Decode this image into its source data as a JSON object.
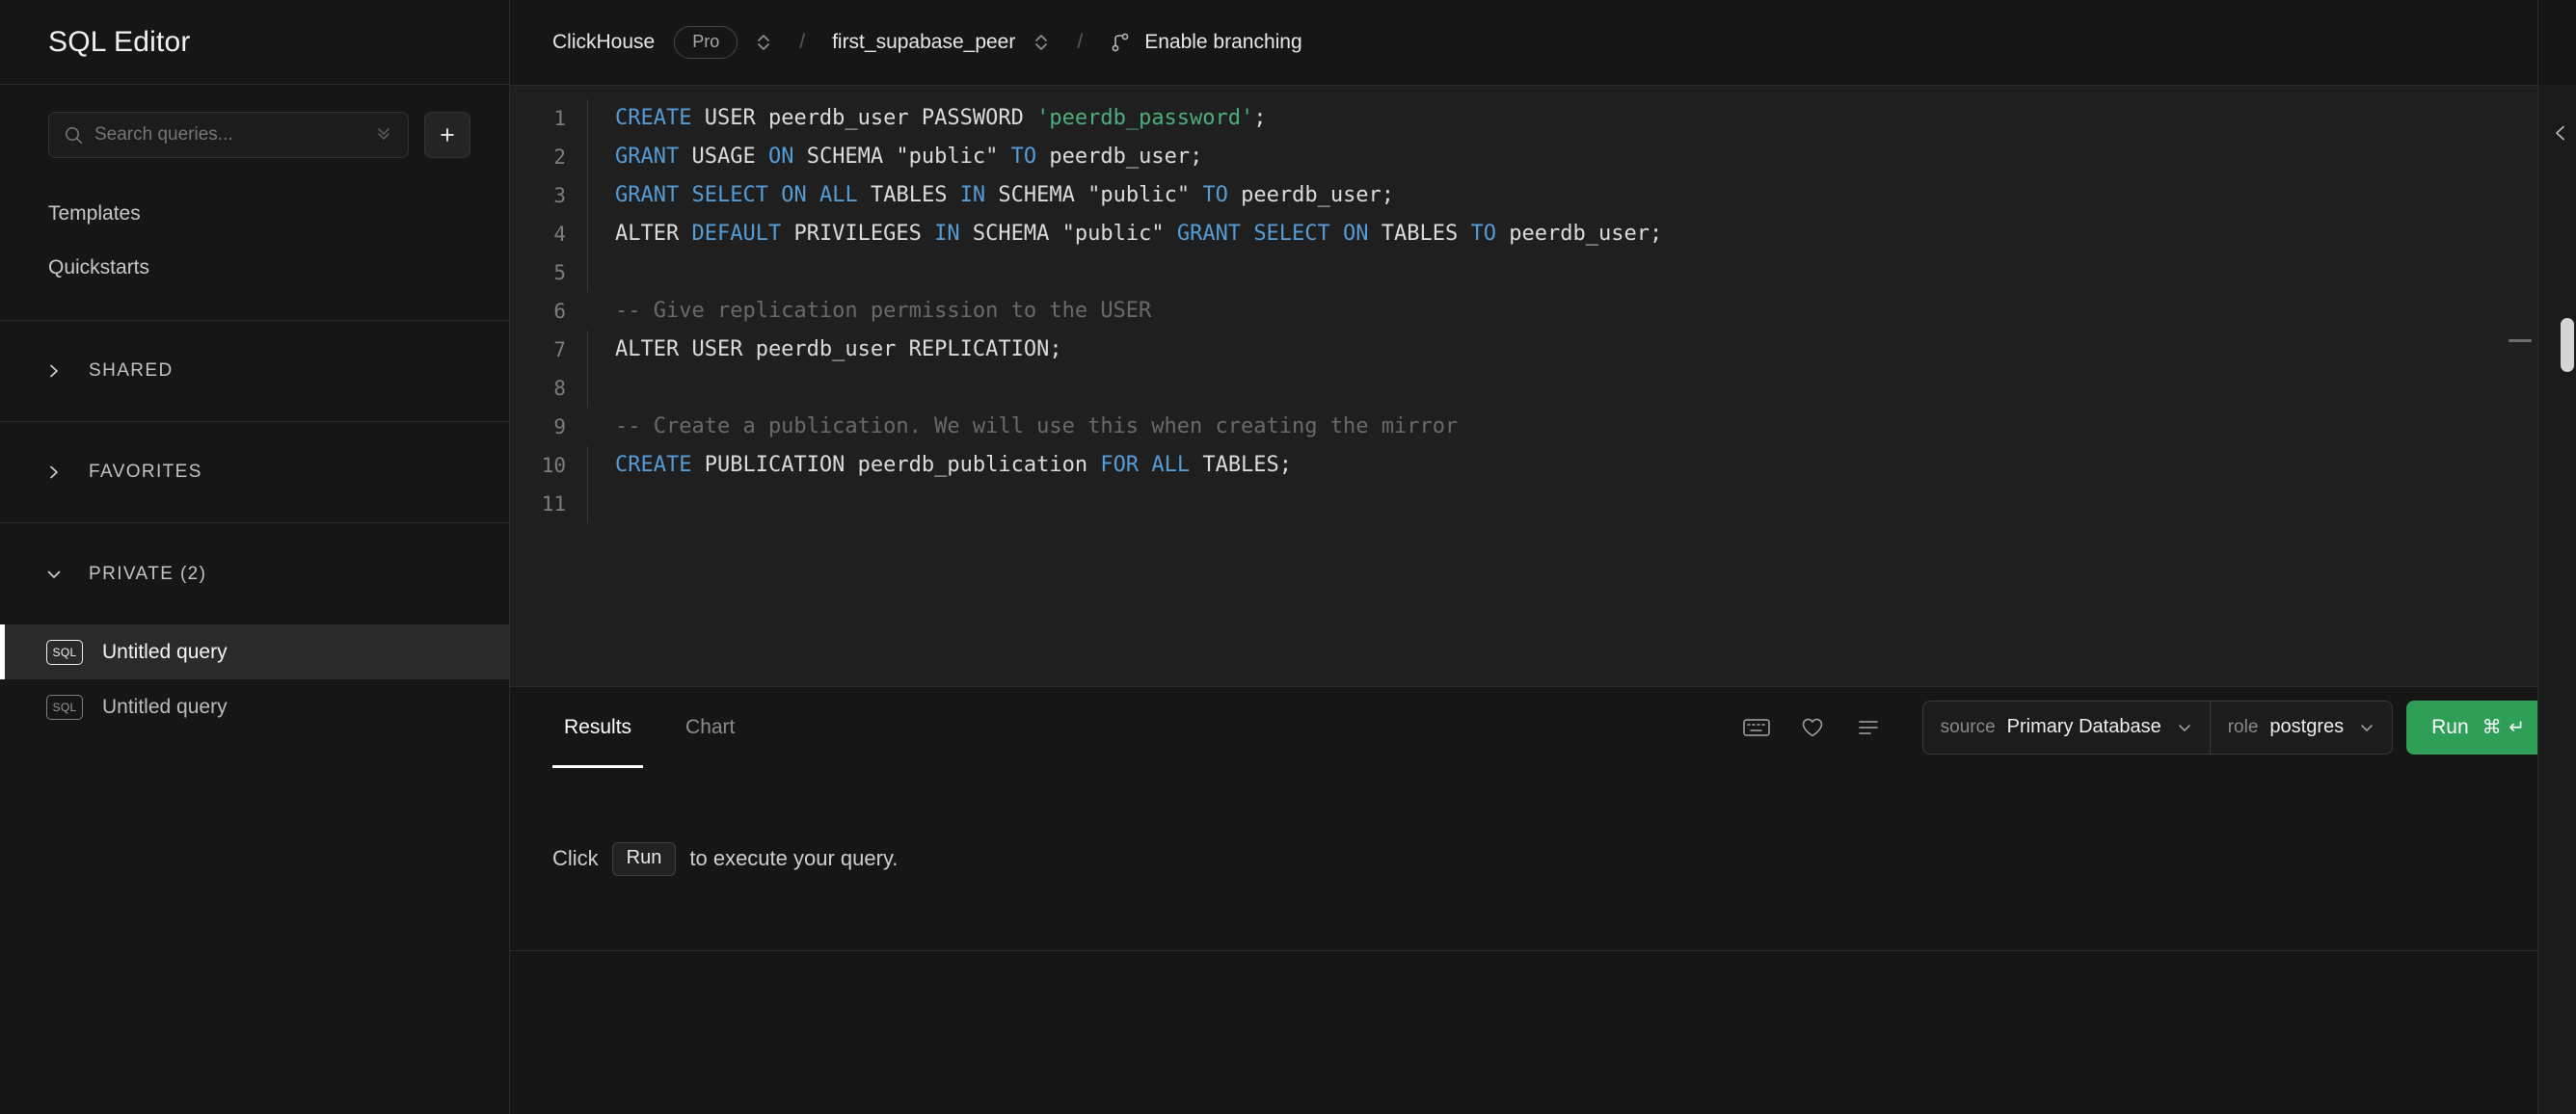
{
  "sidebar": {
    "title": "SQL Editor",
    "search": {
      "placeholder": "Search queries...",
      "icon": "search-icon",
      "expand_icon": "chevrons-down-icon"
    },
    "new_query_label": "+",
    "links": [
      {
        "label": "Templates"
      },
      {
        "label": "Quickstarts"
      }
    ],
    "groups": [
      {
        "label": "SHARED",
        "expanded": false,
        "caret": "chevron-right-icon"
      },
      {
        "label": "FAVORITES",
        "expanded": false,
        "caret": "chevron-right-icon"
      },
      {
        "label": "PRIVATE (2)",
        "expanded": true,
        "caret": "chevron-down-icon"
      }
    ],
    "queries": [
      {
        "badge": "SQL",
        "label": "Untitled query",
        "active": true
      },
      {
        "badge": "SQL",
        "label": "Untitled query",
        "active": false
      }
    ]
  },
  "topbar": {
    "service_name": "ClickHouse",
    "tier_badge": "Pro",
    "separator": "/",
    "database": "first_supabase_peer",
    "branching_label": "Enable branching",
    "branch_icon": "git-branch-icon",
    "selector_icon": "chevron-up-down-icon"
  },
  "editor": {
    "lines": [
      {
        "n": "1",
        "tokens": [
          {
            "t": "CREATE",
            "c": "kw"
          },
          {
            "t": " USER peerdb_user PASSWORD ",
            "c": ""
          },
          {
            "t": "'peerdb_password'",
            "c": "str"
          },
          {
            "t": ";",
            "c": ""
          }
        ]
      },
      {
        "n": "2",
        "tokens": [
          {
            "t": "GRANT",
            "c": "kw"
          },
          {
            "t": " USAGE ",
            "c": ""
          },
          {
            "t": "ON",
            "c": "kw"
          },
          {
            "t": " SCHEMA \"public\" ",
            "c": ""
          },
          {
            "t": "TO",
            "c": "kw"
          },
          {
            "t": " peerdb_user;",
            "c": ""
          }
        ]
      },
      {
        "n": "3",
        "tokens": [
          {
            "t": "GRANT",
            "c": "kw"
          },
          {
            "t": " ",
            "c": ""
          },
          {
            "t": "SELECT",
            "c": "kw"
          },
          {
            "t": " ",
            "c": ""
          },
          {
            "t": "ON",
            "c": "kw"
          },
          {
            "t": " ",
            "c": ""
          },
          {
            "t": "ALL",
            "c": "kw"
          },
          {
            "t": " TABLES ",
            "c": ""
          },
          {
            "t": "IN",
            "c": "kw"
          },
          {
            "t": " SCHEMA \"public\" ",
            "c": ""
          },
          {
            "t": "TO",
            "c": "kw"
          },
          {
            "t": " peerdb_user;",
            "c": ""
          }
        ]
      },
      {
        "n": "4",
        "tokens": [
          {
            "t": "ALTER ",
            "c": ""
          },
          {
            "t": "DEFAULT",
            "c": "kw"
          },
          {
            "t": " PRIVILEGES ",
            "c": ""
          },
          {
            "t": "IN",
            "c": "kw"
          },
          {
            "t": " SCHEMA \"public\" ",
            "c": ""
          },
          {
            "t": "GRANT",
            "c": "kw"
          },
          {
            "t": " ",
            "c": ""
          },
          {
            "t": "SELECT",
            "c": "kw"
          },
          {
            "t": " ",
            "c": ""
          },
          {
            "t": "ON",
            "c": "kw"
          },
          {
            "t": " TABLES ",
            "c": ""
          },
          {
            "t": "TO",
            "c": "kw"
          },
          {
            "t": " peerdb_user;",
            "c": ""
          }
        ]
      },
      {
        "n": "5",
        "tokens": []
      },
      {
        "n": "6",
        "fold": false,
        "tokens": [
          {
            "t": "-- Give replication permission to the USER",
            "c": "cmt"
          }
        ]
      },
      {
        "n": "7",
        "tokens": [
          {
            "t": "ALTER USER peerdb_user REPLICATION;",
            "c": ""
          }
        ]
      },
      {
        "n": "8",
        "tokens": []
      },
      {
        "n": "9",
        "fold": false,
        "tokens": [
          {
            "t": "-- Create a publication. We will use this when creating the mirror",
            "c": "cmt"
          }
        ]
      },
      {
        "n": "10",
        "tokens": [
          {
            "t": "CREATE",
            "c": "kw"
          },
          {
            "t": " PUBLICATION peerdb_publication ",
            "c": ""
          },
          {
            "t": "FOR",
            "c": "kw"
          },
          {
            "t": " ",
            "c": ""
          },
          {
            "t": "ALL",
            "c": "kw"
          },
          {
            "t": " TABLES;",
            "c": ""
          }
        ]
      },
      {
        "n": "11",
        "tokens": []
      }
    ]
  },
  "results": {
    "tabs": [
      {
        "label": "Results",
        "active": true
      },
      {
        "label": "Chart",
        "active": false
      }
    ],
    "toolbar_icons": [
      {
        "name": "keyboard-icon"
      },
      {
        "name": "heart-icon"
      },
      {
        "name": "list-icon"
      }
    ],
    "source_key": "source",
    "source_value": "Primary Database",
    "role_key": "role",
    "role_value": "postgres",
    "run_label": "Run",
    "run_shortcut": "⌘ ↵",
    "run_color": "#2f9e57",
    "hint_prefix": "Click",
    "hint_kbd": "Run",
    "hint_suffix": "to execute your query."
  }
}
